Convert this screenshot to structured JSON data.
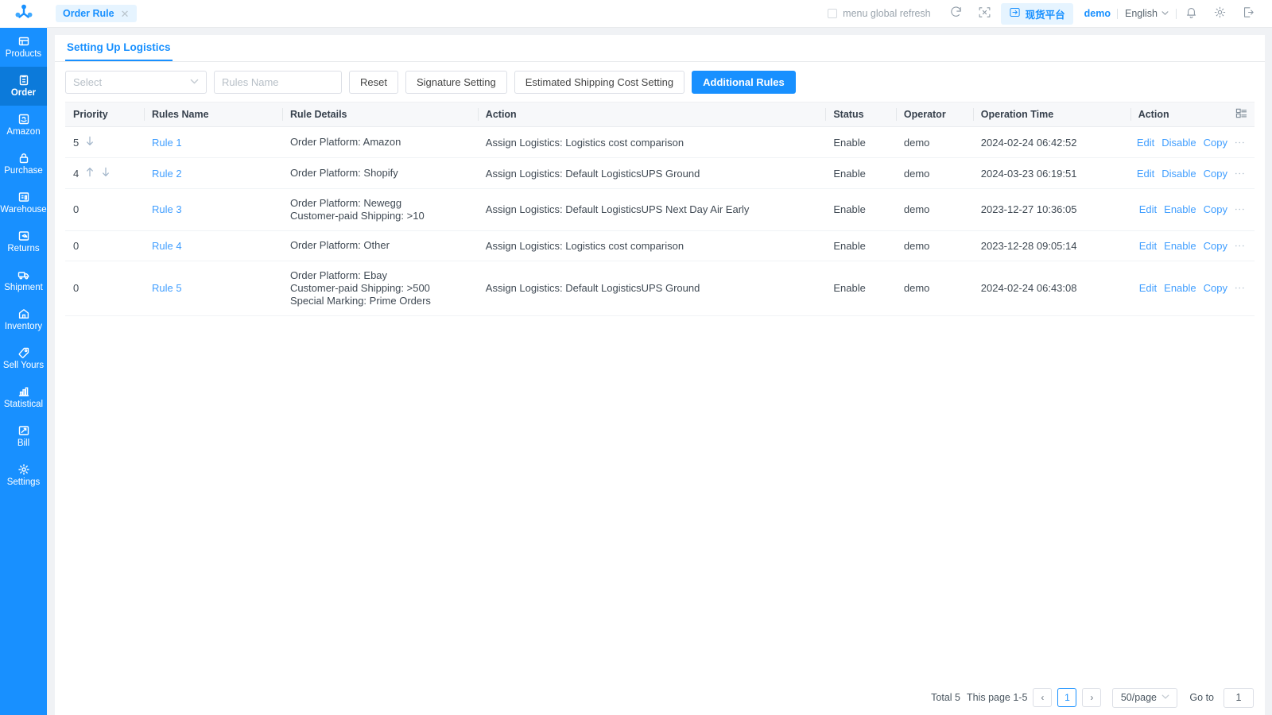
{
  "brand": {
    "accent": "#1890ff",
    "link": "#409eff",
    "sidebar_bg": "#1890ff",
    "sidebar_active_bg": "#0c7ada"
  },
  "header": {
    "tab_label": "Order Rule",
    "tab_close": "✕",
    "global_refresh_label": "menu global refresh",
    "platform_label": "现货平台",
    "user": "demo",
    "language": "English",
    "icons": [
      "logo-icon",
      "refresh-icon",
      "collapse-icon",
      "login-icon",
      "bell-icon",
      "gear-icon",
      "logout-icon"
    ]
  },
  "sidebar": {
    "items": [
      {
        "label": "Products",
        "icon": "products-icon",
        "active": false
      },
      {
        "label": "Order",
        "icon": "order-icon",
        "active": true
      },
      {
        "label": "Amazon",
        "icon": "amazon-icon",
        "active": false
      },
      {
        "label": "Purchase",
        "icon": "purchase-icon",
        "active": false
      },
      {
        "label": "Warehouse",
        "icon": "warehouse-icon",
        "active": false
      },
      {
        "label": "Returns",
        "icon": "returns-icon",
        "active": false
      },
      {
        "label": "Shipment",
        "icon": "shipment-icon",
        "active": false
      },
      {
        "label": "Inventory",
        "icon": "inventory-icon",
        "active": false
      },
      {
        "label": "Sell Yours",
        "icon": "sell-yours-icon",
        "active": false
      },
      {
        "label": "Statistical",
        "icon": "statistical-icon",
        "active": false
      },
      {
        "label": "Bill",
        "icon": "bill-icon",
        "active": false
      },
      {
        "label": "Settings",
        "icon": "settings-icon",
        "active": false
      }
    ]
  },
  "main": {
    "tab_label": "Setting Up Logistics",
    "toolbar": {
      "select_placeholder": "Select",
      "rules_name_placeholder": "Rules Name",
      "rules_name_value": "",
      "reset_label": "Reset",
      "signature_label": "Signature Setting",
      "estimated_label": "Estimated Shipping Cost Setting",
      "additional_label": "Additional Rules"
    },
    "table": {
      "columns": [
        "Priority",
        "Rules Name",
        "Rule Details",
        "Action",
        "Status",
        "Operator",
        "Operation Time",
        "Action"
      ],
      "column_config_icon": "column-settings-icon",
      "rows": [
        {
          "priority": "5",
          "arrows": [
            "down"
          ],
          "rule_name": "Rule 1",
          "details": [
            "Order Platform: Amazon"
          ],
          "action": "Assign Logistics: Logistics cost comparison",
          "status": "Enable",
          "operator": "demo",
          "operation_time": "2024-02-24 06:42:52",
          "ops": [
            "Edit",
            "Disable",
            "Copy"
          ]
        },
        {
          "priority": "4",
          "arrows": [
            "up",
            "down"
          ],
          "rule_name": "Rule 2",
          "details": [
            "Order Platform: Shopify"
          ],
          "action": "Assign Logistics: Default LogisticsUPS Ground",
          "status": "Enable",
          "operator": "demo",
          "operation_time": "2024-03-23 06:19:51",
          "ops": [
            "Edit",
            "Disable",
            "Copy"
          ]
        },
        {
          "priority": "0",
          "arrows": [],
          "rule_name": "Rule 3",
          "details": [
            "Order Platform: Newegg",
            "Customer-paid Shipping: >10"
          ],
          "action": "Assign Logistics: Default LogisticsUPS Next Day Air Early",
          "status": "Enable",
          "operator": "demo",
          "operation_time": "2023-12-27 10:36:05",
          "ops": [
            "Edit",
            "Enable",
            "Copy"
          ]
        },
        {
          "priority": "0",
          "arrows": [],
          "rule_name": "Rule 4",
          "details": [
            "Order Platform: Other"
          ],
          "action": "Assign Logistics: Logistics cost comparison",
          "status": "Enable",
          "operator": "demo",
          "operation_time": "2023-12-28 09:05:14",
          "ops": [
            "Edit",
            "Enable",
            "Copy"
          ]
        },
        {
          "priority": "0",
          "arrows": [],
          "rule_name": "Rule 5",
          "details": [
            "Order Platform: Ebay",
            "Customer-paid Shipping: >500",
            "Special Marking: Prime Orders"
          ],
          "action": "Assign Logistics: Default LogisticsUPS Ground",
          "status": "Enable",
          "operator": "demo",
          "operation_time": "2024-02-24 06:43:08",
          "ops": [
            "Edit",
            "Enable",
            "Copy"
          ]
        }
      ]
    },
    "pagination": {
      "total": "Total 5",
      "range": "This page 1-5",
      "prev": "‹",
      "current_page": "1",
      "next": "›",
      "page_size": "50/page",
      "goto_label": "Go to",
      "goto_value": "1"
    }
  }
}
